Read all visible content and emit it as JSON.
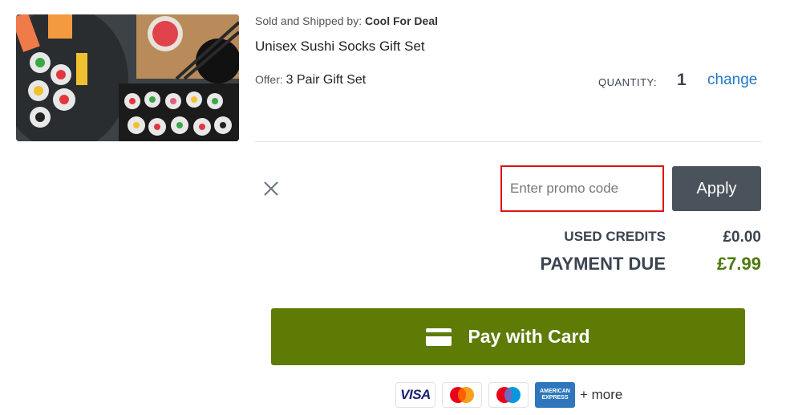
{
  "product": {
    "image_alt": "Unisex Sushi Socks Gift Set",
    "seller_label": "Sold and Shipped by:",
    "seller_name": "Cool For Deal",
    "title": "Unisex Sushi Socks Gift Set",
    "offer_label": "Offer:",
    "offer_value": "3 Pair Gift Set",
    "quantity_label": "QUANTITY:",
    "quantity_value": "1",
    "change_label": "change"
  },
  "promo": {
    "placeholder": "Enter promo code",
    "value": "",
    "apply_label": "Apply"
  },
  "summary": {
    "used_credits_label": "USED CREDITS",
    "used_credits_value": "£0.00",
    "payment_due_label": "PAYMENT DUE",
    "payment_due_value": "£7.99"
  },
  "pay": {
    "label": "Pay with Card",
    "icon": "credit-card-icon"
  },
  "payment_methods": {
    "visa": "VISA",
    "amex_line1": "AMERICAN",
    "amex_line2": "EXPRESS",
    "more": "+ more",
    "icons": [
      "visa-logo",
      "mastercard-logo",
      "maestro-logo",
      "amex-logo"
    ]
  },
  "colors": {
    "pay_button": "#5e7b06",
    "apply_button": "#4a535c",
    "payment_due_value": "#4c7a0c",
    "link": "#1e78c8",
    "promo_border": "#e01010"
  }
}
